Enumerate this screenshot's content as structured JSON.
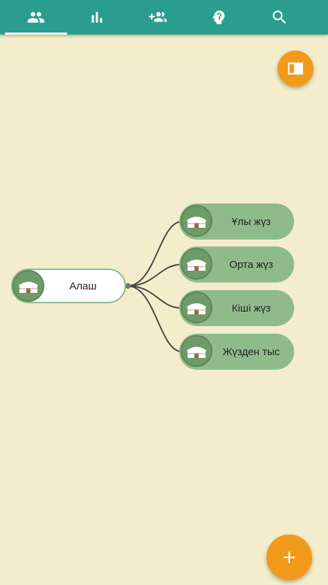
{
  "tabs": [
    {
      "icon": "people-icon",
      "active": true
    },
    {
      "icon": "bar-chart-icon",
      "active": false
    },
    {
      "icon": "add-group-icon",
      "active": false
    },
    {
      "icon": "head-question-icon",
      "active": false
    },
    {
      "icon": "search-icon",
      "active": false
    }
  ],
  "tree": {
    "root": {
      "label": "Алаш",
      "icon": "yurt-icon"
    },
    "children": [
      {
        "label": "Ұлы жүз",
        "icon": "yurt-icon"
      },
      {
        "label": "Орта жүз",
        "icon": "yurt-icon"
      },
      {
        "label": "Кіші жүз",
        "icon": "yurt-icon"
      },
      {
        "label": "Жүзден тыс",
        "icon": "yurt-icon"
      }
    ]
  },
  "fabs": {
    "book": {
      "icon": "open-book-icon"
    },
    "add": {
      "icon": "plus-icon"
    }
  },
  "colors": {
    "header": "#2a9d8f",
    "background": "#f3edcb",
    "node_fill": "#8fbb8a",
    "avatar": "#6f9a69",
    "fab": "#f29a1b",
    "connector": "#444444"
  }
}
